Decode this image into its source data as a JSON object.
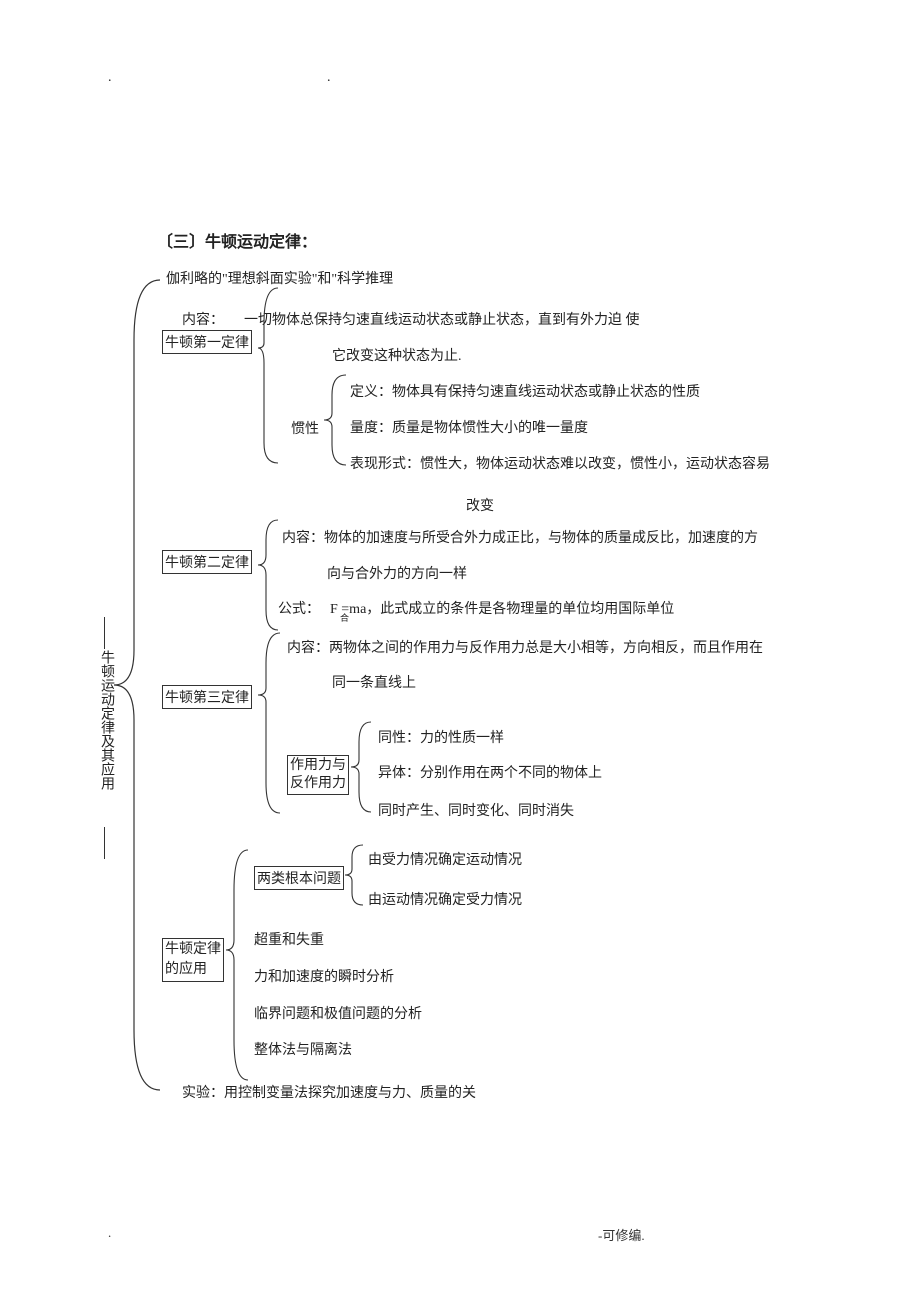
{
  "header": {
    "dot1": ".",
    "dot2": "."
  },
  "title": "〔三〕牛顿运动定律：",
  "intro": "伽利略的\"理想斜面实验\"和\"科学推理",
  "root_label": "牛顿运动定律及其应用",
  "law1": {
    "label": "牛顿第一定律",
    "content_label": "内容：",
    "content_line1": "一切物体总保持匀速直线运动状态或静止状态，直到有外力迫  使",
    "content_line2": "它改变这种状态为止.",
    "inertia_label": "惯性",
    "inertia_def": "定义：物体具有保持匀速直线运动状态或静止状态的性质",
    "inertia_measure": "量度：质量是物体惯性大小的唯一量度",
    "inertia_form1": "表现形式：惯性大，物体运动状态难以改变，惯性小，运动状态容易",
    "inertia_form2": "改变"
  },
  "law2": {
    "label": "牛顿第二定律",
    "content_label": "内容：",
    "content_line1": "物体的加速度与所受合外力成正比，与物体的质量成反比，加速度的方",
    "content_line2": "向与合外力的方向一样",
    "formula_label": "公式：",
    "formula_text": "F  =ma，此式成立的条件是各物理量的单位均用国际单位",
    "formula_sub": "合"
  },
  "law3": {
    "label": "牛顿第三定律",
    "content_label": "内容：",
    "content_line1": "两物体之间的作用力与反作用力总是大小相等，方向相反，而且作用在",
    "content_line2": "同一条直线上",
    "pair_label1": "作用力与",
    "pair_label2": "反作用力",
    "same_nature": "同性：力的性质一样",
    "diff_body": "异体：分别作用在两个不同的物体上",
    "simultaneity": "同时产生、同时变化、同时消失"
  },
  "app": {
    "label1": "牛顿定律",
    "label2": "的应用",
    "two_prob_label": "两类根本问题",
    "prob1": "由受力情况确定运动情况",
    "prob2": "由运动情况确定受力情况",
    "item1": "超重和失重",
    "item2": "力和加速度的瞬时分析",
    "item3": "临界问题和极值问题的分析",
    "item4": "整体法与隔离法"
  },
  "experiment": "实验：用控制变量法探究加速度与力、质量的关",
  "footer": {
    "dot": ".",
    "note": "-可修编."
  }
}
